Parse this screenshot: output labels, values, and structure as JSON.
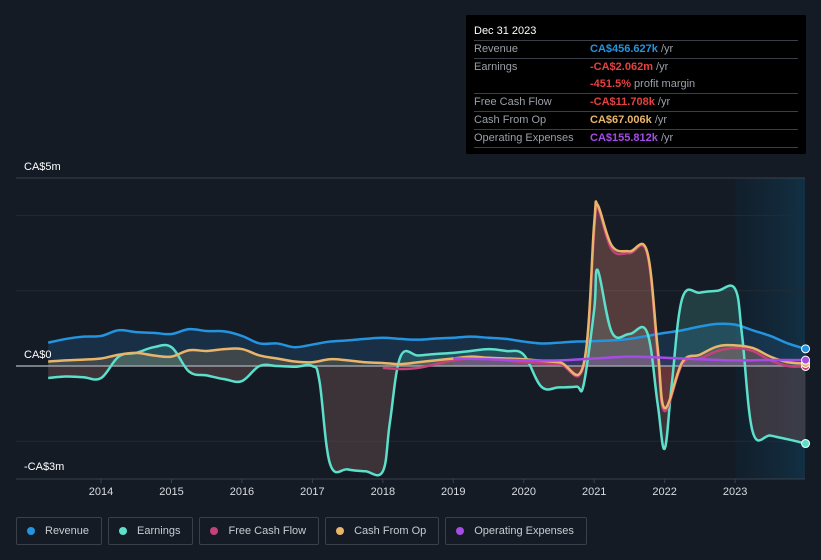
{
  "tooltip": {
    "date": "Dec 31 2023",
    "rows": [
      {
        "label": "Revenue",
        "value": "CA$456.627k",
        "suffix": " /yr",
        "color": "#2394df"
      },
      {
        "label": "Earnings",
        "value": "-CA$2.062m",
        "suffix": " /yr",
        "color": "#e64141"
      },
      {
        "label": "",
        "value": "-451.5%",
        "suffix": " profit margin",
        "color": "#e64141"
      },
      {
        "label": "Free Cash Flow",
        "value": "-CA$11.708k",
        "suffix": " /yr",
        "color": "#e64141"
      },
      {
        "label": "Cash From Op",
        "value": "CA$67.006k",
        "suffix": " /yr",
        "color": "#e9b56a"
      },
      {
        "label": "Operating Expenses",
        "value": "CA$155.812k",
        "suffix": " /yr",
        "color": "#a54ce6"
      }
    ]
  },
  "legend": [
    {
      "label": "Revenue",
      "color": "#2394df"
    },
    {
      "label": "Earnings",
      "color": "#5ce0cb"
    },
    {
      "label": "Free Cash Flow",
      "color": "#c4427a"
    },
    {
      "label": "Cash From Op",
      "color": "#e9b56a"
    },
    {
      "label": "Operating Expenses",
      "color": "#a54ce6"
    }
  ],
  "chart_data": {
    "type": "area",
    "title": "",
    "xlabel": "",
    "ylabel": "",
    "unit": "CA$ millions",
    "y_tick_labels": [
      "CA$5m",
      "CA$0",
      "-CA$3m"
    ],
    "y_ticks": [
      5,
      0,
      -3
    ],
    "ylim": [
      -3,
      5
    ],
    "xlim": [
      2013.0,
      2024.0
    ],
    "x_ticks": [
      2014,
      2015,
      2016,
      2017,
      2018,
      2019,
      2020,
      2021,
      2022,
      2023
    ],
    "x_tick_labels": [
      "2014",
      "2015",
      "2016",
      "2017",
      "2018",
      "2019",
      "2020",
      "2021",
      "2022",
      "2023"
    ],
    "grid": true,
    "highlight_range": [
      2023.0,
      2024.0
    ],
    "legend_position": "bottom-left",
    "series": [
      {
        "name": "Revenue",
        "color": "#2394df",
        "x": [
          2013.25,
          2013.5,
          2013.75,
          2014.0,
          2014.25,
          2014.5,
          2014.75,
          2015.0,
          2015.25,
          2015.5,
          2015.75,
          2016.0,
          2016.25,
          2016.5,
          2016.75,
          2017.0,
          2017.25,
          2017.5,
          2017.75,
          2018.0,
          2018.25,
          2018.5,
          2018.75,
          2019.0,
          2019.25,
          2019.5,
          2019.75,
          2020.0,
          2020.25,
          2020.5,
          2020.75,
          2021.0,
          2021.25,
          2021.5,
          2021.75,
          2022.0,
          2022.25,
          2022.5,
          2022.75,
          2023.0,
          2023.25,
          2023.5,
          2023.75,
          2024.0
        ],
        "values": [
          0.62,
          0.72,
          0.78,
          0.8,
          0.95,
          0.9,
          0.88,
          0.85,
          0.98,
          0.93,
          0.92,
          0.8,
          0.6,
          0.6,
          0.5,
          0.57,
          0.65,
          0.68,
          0.72,
          0.75,
          0.72,
          0.7,
          0.73,
          0.75,
          0.78,
          0.75,
          0.72,
          0.65,
          0.6,
          0.62,
          0.65,
          0.66,
          0.68,
          0.72,
          0.8,
          0.88,
          0.95,
          1.05,
          1.12,
          1.1,
          0.95,
          0.8,
          0.6,
          0.457
        ]
      },
      {
        "name": "Earnings",
        "color": "#5ce0cb",
        "x": [
          2013.25,
          2013.5,
          2013.75,
          2014.0,
          2014.25,
          2014.5,
          2014.75,
          2015.0,
          2015.25,
          2015.5,
          2015.75,
          2016.0,
          2016.25,
          2016.5,
          2016.75,
          2017.0,
          2017.1,
          2017.25,
          2017.5,
          2017.75,
          2018.0,
          2018.1,
          2018.25,
          2018.5,
          2018.75,
          2019.0,
          2019.25,
          2019.5,
          2019.75,
          2020.0,
          2020.25,
          2020.5,
          2020.75,
          2020.85,
          2021.0,
          2021.05,
          2021.25,
          2021.5,
          2021.75,
          2021.9,
          2022.0,
          2022.1,
          2022.25,
          2022.5,
          2022.75,
          2023.0,
          2023.1,
          2023.25,
          2023.5,
          2023.75,
          2024.0
        ],
        "values": [
          -0.32,
          -0.28,
          -0.3,
          -0.32,
          0.25,
          0.35,
          0.5,
          0.5,
          -0.15,
          -0.25,
          -0.35,
          -0.4,
          0.0,
          0.0,
          -0.02,
          0.0,
          -0.4,
          -2.6,
          -2.75,
          -2.8,
          -2.8,
          -1.5,
          0.25,
          0.28,
          0.32,
          0.35,
          0.4,
          0.45,
          0.4,
          0.3,
          -0.55,
          -0.57,
          -0.55,
          -0.5,
          1.5,
          2.55,
          0.9,
          0.85,
          0.9,
          -1.0,
          -2.2,
          -0.5,
          1.8,
          1.95,
          2.0,
          2.05,
          0.8,
          -1.75,
          -1.85,
          -1.95,
          -2.062
        ]
      },
      {
        "name": "Free Cash Flow",
        "color": "#c4427a",
        "x": [
          2018.0,
          2018.25,
          2018.5,
          2018.75,
          2019.0,
          2019.25,
          2019.5,
          2019.75,
          2020.0,
          2020.5,
          2020.85,
          2021.0,
          2021.05,
          2021.25,
          2021.5,
          2021.75,
          2021.9,
          2022.0,
          2022.25,
          2022.5,
          2022.75,
          2023.0,
          2023.25,
          2023.5,
          2023.75,
          2024.0
        ],
        "values": [
          -0.05,
          -0.08,
          -0.05,
          0.05,
          0.15,
          0.2,
          0.18,
          0.15,
          0.1,
          0.05,
          0.0,
          3.6,
          4.2,
          3.1,
          3.0,
          3.0,
          0.3,
          -1.2,
          0.05,
          0.2,
          0.4,
          0.48,
          0.4,
          0.15,
          0.0,
          -0.012
        ]
      },
      {
        "name": "Cash From Op",
        "color": "#e9b56a",
        "x": [
          2013.25,
          2013.5,
          2013.75,
          2014.0,
          2014.25,
          2014.5,
          2014.75,
          2015.0,
          2015.25,
          2015.5,
          2015.75,
          2016.0,
          2016.25,
          2016.5,
          2016.75,
          2017.0,
          2017.25,
          2017.5,
          2017.75,
          2018.0,
          2018.25,
          2018.5,
          2018.75,
          2019.0,
          2019.25,
          2019.5,
          2019.75,
          2020.0,
          2020.5,
          2020.85,
          2021.0,
          2021.05,
          2021.25,
          2021.5,
          2021.75,
          2021.9,
          2022.0,
          2022.25,
          2022.5,
          2022.75,
          2023.0,
          2023.25,
          2023.5,
          2023.75,
          2024.0
        ],
        "values": [
          0.12,
          0.15,
          0.17,
          0.2,
          0.3,
          0.35,
          0.28,
          0.25,
          0.42,
          0.4,
          0.45,
          0.45,
          0.28,
          0.2,
          0.12,
          0.1,
          0.18,
          0.15,
          0.1,
          0.08,
          0.05,
          0.1,
          0.15,
          0.2,
          0.25,
          0.22,
          0.2,
          0.18,
          0.1,
          0.05,
          3.8,
          4.28,
          3.2,
          3.05,
          3.05,
          0.5,
          -1.12,
          0.1,
          0.3,
          0.52,
          0.55,
          0.48,
          0.25,
          0.1,
          0.067
        ]
      },
      {
        "name": "Operating Expenses",
        "color": "#a54ce6",
        "x": [
          2019.0,
          2019.5,
          2020.0,
          2020.5,
          2021.0,
          2021.5,
          2022.0,
          2022.5,
          2023.0,
          2023.5,
          2024.0
        ],
        "values": [
          0.2,
          0.18,
          0.15,
          0.15,
          0.2,
          0.25,
          0.22,
          0.18,
          0.15,
          0.16,
          0.156
        ]
      }
    ]
  }
}
